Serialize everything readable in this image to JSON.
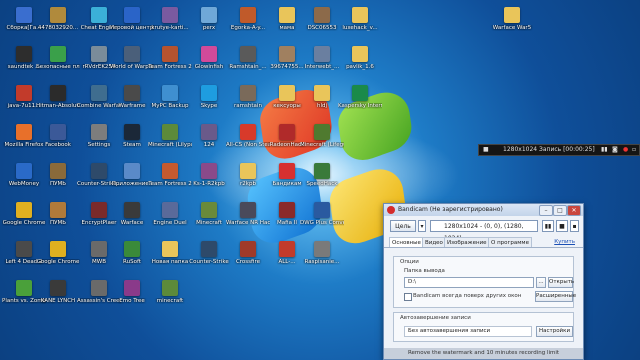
{
  "desktop": {
    "icons": [
      {
        "label": "Сборка[Га...",
        "color": "#3a6ecf"
      },
      {
        "label": "4478032920...",
        "color": "#b08a3c"
      },
      {
        "label": "Cheat Engine",
        "color": "#3bb0d8"
      },
      {
        "label": "Игровой центр@Mail.ru",
        "color": "#2a64c8"
      },
      {
        "label": "krutye-karti...",
        "color": "#7a5aa0"
      },
      {
        "label": "perx",
        "color": "#6fa8d8"
      },
      {
        "label": "Egorka-A-y...",
        "color": "#c05a2a"
      },
      {
        "label": "мама",
        "color": "#e9c55a"
      },
      {
        "label": "DSC06553",
        "color": "#8c6a4a"
      },
      {
        "label": "luxehack_v...",
        "color": "#e9c55a"
      },
      {
        "label": "Warface War5",
        "color": "#e9c55a"
      },
      {
        "label": "saundtek ...",
        "color": "#2d2d2d"
      },
      {
        "label": "Безопасные платежи",
        "color": "#3aa04a"
      },
      {
        "label": "rRVdrEK254",
        "color": "#7a8c9a"
      },
      {
        "label": "World of Warplanes",
        "color": "#4a5f7a"
      },
      {
        "label": "Team Fortress 2",
        "color": "#b5532f"
      },
      {
        "label": "Glowinfish",
        "color": "#d14a9a"
      },
      {
        "label": "Ramshtain_...",
        "color": "#5a5a5a"
      },
      {
        "label": "39674755...",
        "color": "#a08060"
      },
      {
        "label": "Interwebt_...",
        "color": "#6a7fa0"
      },
      {
        "label": "pavlik_1.6",
        "color": "#e9c55a"
      },
      {
        "label": "java-7u11...",
        "color": "#c23b2b"
      },
      {
        "label": "Hitman-Absolution",
        "color": "#2b2b2b"
      },
      {
        "label": "Combine Warfare",
        "color": "#3f6d8f"
      },
      {
        "label": "Warframe",
        "color": "#4a4a4a"
      },
      {
        "label": "MyPC Backup",
        "color": "#3f8fd0"
      },
      {
        "label": "Skype",
        "color": "#1e9de0"
      },
      {
        "label": "ramshtain",
        "color": "#7a6a5a"
      },
      {
        "label": "кексуоры",
        "color": "#e9c55a"
      },
      {
        "label": "hldj",
        "color": "#e9c55a"
      },
      {
        "label": "Kaspersky Internet Se...",
        "color": "#1a8a4a"
      },
      {
        "label": "Mozilla Firefox",
        "color": "#e8702a"
      },
      {
        "label": "Facebook",
        "color": "#3b5998"
      },
      {
        "label": "Settings",
        "color": "#7d7d7d"
      },
      {
        "label": "Steam",
        "color": "#1b2838"
      },
      {
        "label": "Minecraft (Lilypad)",
        "color": "#5c8a3a"
      },
      {
        "label": "124",
        "color": "#6a5a8a"
      },
      {
        "label": "All-CS (Non Steam)",
        "color": "#d83a2a"
      },
      {
        "label": "RadeonHack",
        "color": "#b02a2a"
      },
      {
        "label": "Minecraft (Lifeguard)",
        "color": "#4f7a2f"
      },
      {
        "label": "WebMoney",
        "color": "#2a6ac8"
      },
      {
        "label": "ПУМЬ",
        "color": "#8a6a3a"
      },
      {
        "label": "Counter-Strike...",
        "color": "#2e4a6a"
      },
      {
        "label": "Приложение..",
        "color": "#5a8ac8"
      },
      {
        "label": "Team Fortress 2",
        "color": "#c45a2f"
      },
      {
        "label": "Ks-1-R2kpb",
        "color": "#8a4a8a"
      },
      {
        "label": "r2kpb",
        "color": "#e9c55a"
      },
      {
        "label": "Бандикам",
        "color": "#d63030"
      },
      {
        "label": "SpeedHack",
        "color": "#3a7a3a"
      },
      {
        "label": "Google Chrome",
        "color": "#e0b020"
      },
      {
        "label": "ПУМЬ",
        "color": "#b07a3a"
      },
      {
        "label": "EncryptPlaer",
        "color": "#7a2a2a"
      },
      {
        "label": "Warface",
        "color": "#3a3a3a"
      },
      {
        "label": "Engine Duel",
        "color": "#5a6a9a"
      },
      {
        "label": "Minecraft",
        "color": "#6a8a3a"
      },
      {
        "label": "Warface NR Hackin..",
        "color": "#4a4a5a"
      },
      {
        "label": "Mafia II",
        "color": "#8a2a2a"
      },
      {
        "label": "DWG Plus Converter",
        "color": "#2a5aa0"
      },
      {
        "label": "Left 4 Dead 2",
        "color": "#4a4a4a"
      },
      {
        "label": "Google Chrome",
        "color": "#e0b020"
      },
      {
        "label": "MWB",
        "color": "#6a6a6a"
      },
      {
        "label": "RuSoft",
        "color": "#3a8a3a"
      },
      {
        "label": "Новая папка",
        "color": "#e9c55a"
      },
      {
        "label": "Counter-Strike",
        "color": "#2e4a6a"
      },
      {
        "label": "Crossfire",
        "color": "#a03a2a"
      },
      {
        "label": "ALL-...",
        "color": "#c23b2b"
      },
      {
        "label": "Raspisanie...",
        "color": "#7a7a7a"
      },
      {
        "label": "Plants vs. Zombies",
        "color": "#4aa03a"
      },
      {
        "label": "KANE LYNCH",
        "color": "#3a3a3a"
      },
      {
        "label": "Assassin's Creed III",
        "color": "#6a6a6a"
      },
      {
        "label": "Emo Tree",
        "color": "#8a3a8a"
      },
      {
        "label": "minecraft",
        "color": "#5c8a3a"
      }
    ]
  },
  "recbar": {
    "resolution": "1280x1024",
    "recording": "Запись [00:00:25]"
  },
  "bandicam": {
    "title": "Bandicam (Не зарегистрировано)",
    "target_button": "Цель",
    "target_info": "1280x1024 - (0, 0), (1280, 1024)",
    "tabs": [
      "Основные",
      "Видео",
      "Изображение",
      "О программе"
    ],
    "help": "Купить",
    "options": {
      "group_title": "Опции",
      "output_label": "Папка вывода",
      "output_path": "D:\\",
      "browse_button": "...",
      "open_button": "Открыть",
      "on_top_label": "Bandicam всегда поверх других окон",
      "advanced_button": "Расширенные"
    },
    "autostop": {
      "group_title": "Автозавершение записи",
      "value": "Без автозавершения записи",
      "settings_button": "Настройки"
    },
    "footer": "Remove the watermark and 10 minutes recording limit"
  }
}
